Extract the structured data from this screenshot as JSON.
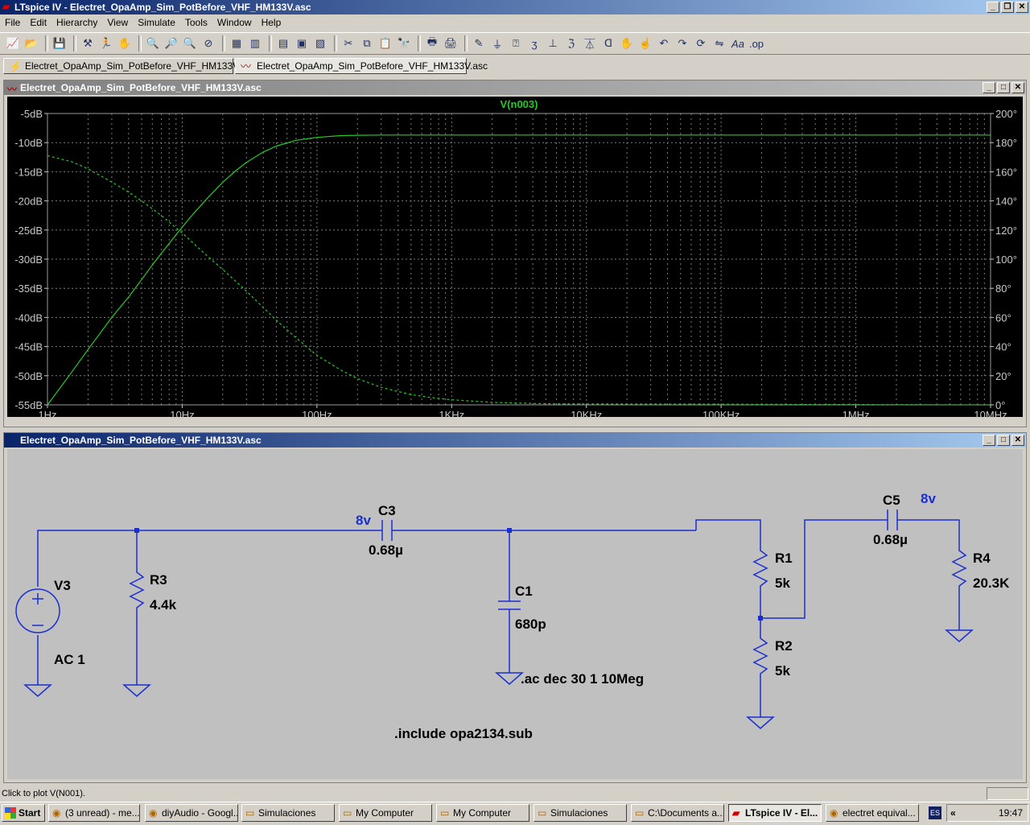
{
  "app": {
    "title": "LTspice IV - Electret_OpaAmp_Sim_PotBefore_VHF_HM133V.asc"
  },
  "menu": [
    "File",
    "Edit",
    "Hierarchy",
    "View",
    "Simulate",
    "Tools",
    "Window",
    "Help"
  ],
  "tabs": [
    {
      "label": "Electret_OpaAmp_Sim_PotBefore_VHF_HM133V.asc"
    },
    {
      "label": "Electret_OpaAmp_Sim_PotBefore_VHF_HM133V.asc"
    }
  ],
  "plot_window": {
    "title": "Electret_OpaAmp_Sim_PotBefore_VHF_HM133V.asc"
  },
  "schematic_window": {
    "title": "Electret_OpaAmp_Sim_PotBefore_VHF_HM133V.asc"
  },
  "chart_data": {
    "type": "line",
    "title": "V(n003)",
    "xscale": "log",
    "xlim": [
      1,
      10000000
    ],
    "x_ticks": [
      "1Hz",
      "10Hz",
      "100Hz",
      "1KHz",
      "10KHz",
      "100KHz",
      "1MHz",
      "10MHz"
    ],
    "ylim_left": [
      -55,
      -5
    ],
    "y_ticks_left": [
      "-5dB",
      "-10dB",
      "-15dB",
      "-20dB",
      "-25dB",
      "-30dB",
      "-35dB",
      "-40dB",
      "-45dB",
      "-50dB",
      "-55dB"
    ],
    "ylim_right": [
      0,
      200
    ],
    "y_ticks_right": [
      "200°",
      "180°",
      "160°",
      "140°",
      "120°",
      "100°",
      "80°",
      "60°",
      "40°",
      "20°",
      "0°"
    ],
    "grid": true,
    "trace_color": "#22cc22",
    "background": "#000000",
    "series": [
      {
        "name": "V(n003)",
        "axis": "left",
        "style": "solid",
        "x": [
          1,
          1.5,
          2,
          3,
          4,
          5,
          6,
          7,
          8,
          10,
          12,
          15,
          20,
          25,
          30,
          40,
          50,
          70,
          100,
          150,
          200,
          300,
          1000,
          10000,
          10000000
        ],
        "y": [
          -55,
          -49.5,
          -45.5,
          -40,
          -36.5,
          -33.5,
          -31,
          -29,
          -27.3,
          -24.5,
          -22.3,
          -19.8,
          -16.8,
          -14.8,
          -13.4,
          -11.6,
          -10.6,
          -9.6,
          -9.1,
          -8.8,
          -8.75,
          -8.7,
          -8.7,
          -8.7,
          -8.7
        ]
      },
      {
        "name": "phase",
        "axis": "right",
        "style": "dashed",
        "x": [
          1,
          1.5,
          2,
          3,
          4,
          5,
          7,
          10,
          15,
          20,
          30,
          50,
          70,
          100,
          150,
          200,
          300,
          500,
          700,
          1000,
          2000,
          5000,
          10000000
        ],
        "y": [
          171,
          167,
          162,
          153,
          146,
          140,
          130,
          118,
          103,
          93,
          78,
          58,
          46,
          34,
          24,
          18,
          12,
          7,
          5,
          3.5,
          1.7,
          0.7,
          0
        ]
      }
    ]
  },
  "schematic": {
    "labels": {
      "v3_name": "V3",
      "v3_value": "AC 1",
      "r3_name": "R3",
      "r3_value": "4.4k",
      "c3_name": "C3",
      "c3_value": "0.68µ",
      "c3_net": "8v",
      "c1_name": "C1",
      "c1_value": "680p",
      "r1_name": "R1",
      "r1_value": "5k",
      "r2_name": "R2",
      "r2_value": "5k",
      "c5_name": "C5",
      "c5_value": "0.68µ",
      "c5_net": "8v",
      "r4_name": "R4",
      "r4_value": "20.3K",
      "directive_ac": ".ac dec 30 1 10Meg",
      "directive_include": ".include opa2134.sub"
    },
    "wire_color": "#1a2fd0",
    "text_color": "#000000",
    "net_label_color": "#1a2fd0"
  },
  "status": {
    "text": "Click to plot V(N001)."
  },
  "taskbar": {
    "start": "Start",
    "tasks": [
      "(3 unread) - me...",
      "diyAudio - Googl...",
      "Simulaciones",
      "My Computer",
      "My Computer",
      "Simulaciones",
      "C:\\Documents a...",
      "LTspice IV - El...",
      "electret equival..."
    ],
    "lang": "ES",
    "tray_chevron": "«",
    "clock": "19:47"
  }
}
